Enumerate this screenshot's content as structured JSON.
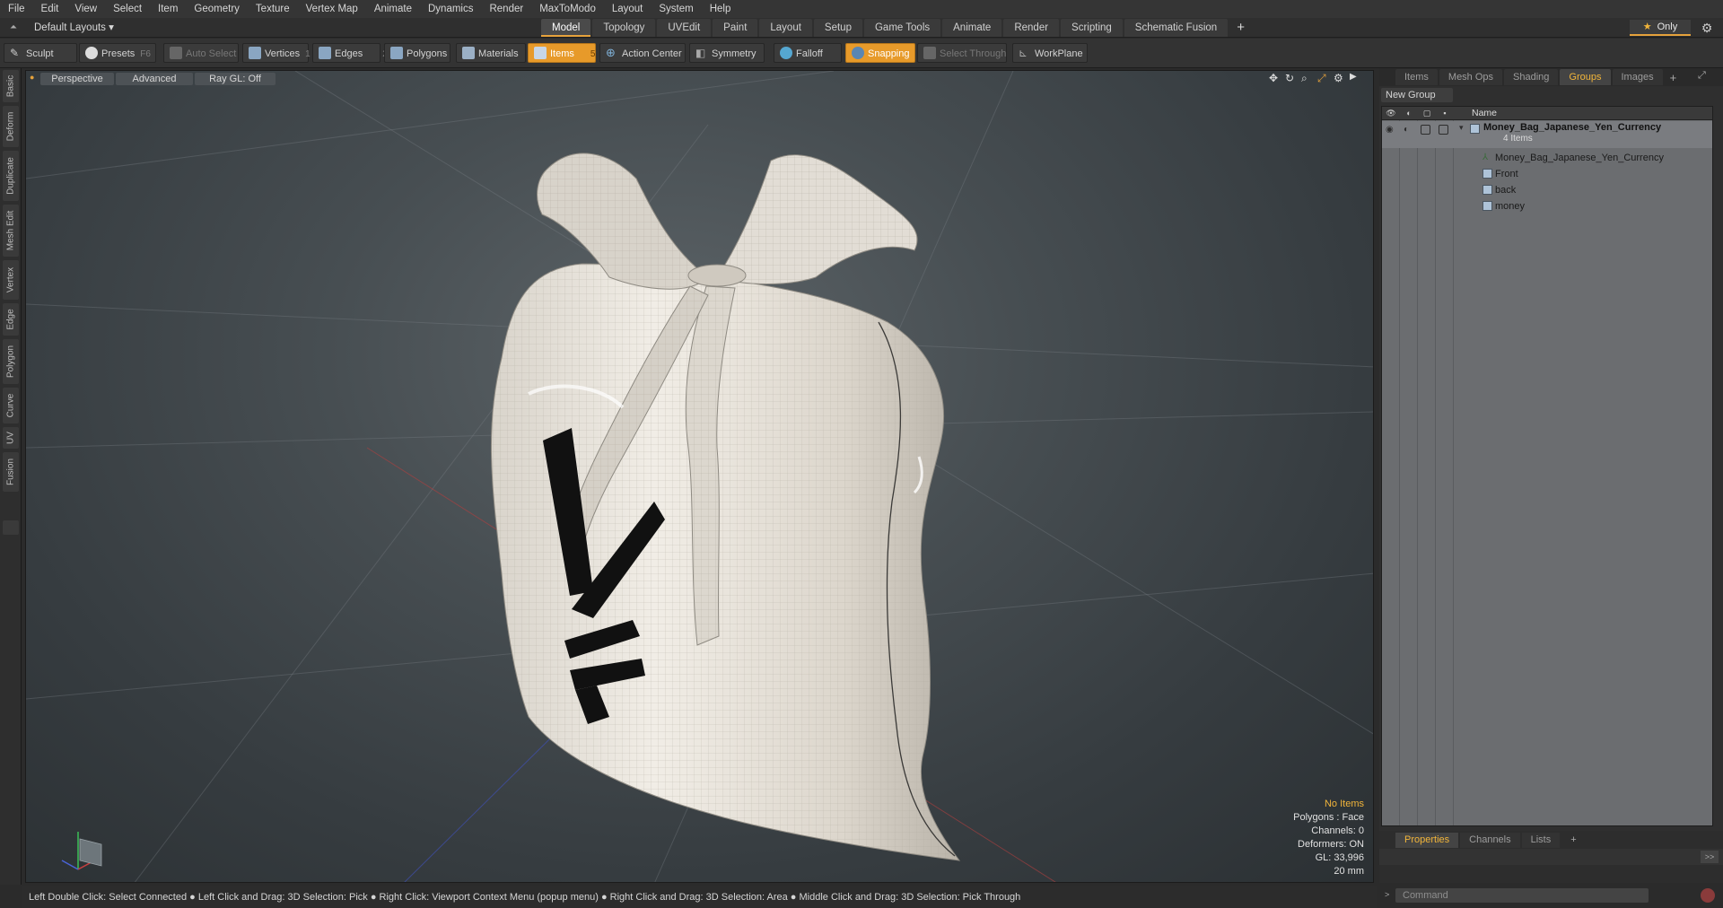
{
  "menu": [
    "File",
    "Edit",
    "View",
    "Select",
    "Item",
    "Geometry",
    "Texture",
    "Vertex Map",
    "Animate",
    "Dynamics",
    "Render",
    "MaxToModo",
    "Layout",
    "System",
    "Help"
  ],
  "layout": {
    "selector": "Default Layouts ▾"
  },
  "tabs": [
    "Model",
    "Topology",
    "UVEdit",
    "Paint",
    "Layout",
    "Setup",
    "Game Tools",
    "Animate",
    "Render",
    "Scripting",
    "Schematic Fusion"
  ],
  "active_tab": "Model",
  "only_label": "Only",
  "toolbar": {
    "sculpt": "Sculpt",
    "presets": "Presets",
    "presets_key": "F6",
    "auto_select": "Auto Select",
    "vertices": "Vertices",
    "vertices_key": "1",
    "edges": "Edges",
    "edges_key": "2",
    "polygons": "Polygons",
    "materials": "Materials",
    "items": "Items",
    "items_key": "5",
    "action_center": "Action Center",
    "symmetry": "Symmetry",
    "falloff": "Falloff",
    "snapping": "Snapping",
    "select_through": "Select Through",
    "workplane": "WorkPlane"
  },
  "left_tabs": [
    "Basic",
    "Deform",
    "Duplicate",
    "Mesh Edit",
    "Vertex",
    "Edge",
    "Polygon",
    "Curve",
    "UV",
    "Fusion"
  ],
  "viewport": {
    "view": "Perspective",
    "shading": "Advanced",
    "raygl": "Ray GL: Off",
    "status": {
      "items": "No Items",
      "polygons": "Polygons : Face",
      "channels": "Channels: 0",
      "deformers": "Deformers: ON",
      "gl": "GL: 33,996",
      "units": "20 mm"
    }
  },
  "right_panel": {
    "tabs": [
      "Items",
      "Mesh Ops",
      "Shading",
      "Groups",
      "Images"
    ],
    "active_tab": "Groups",
    "new_group": "New Group",
    "name_header": "Name",
    "group": {
      "name": "Money_Bag_Japanese_Yen_Currency",
      "count": "4 Items",
      "children": [
        "Money_Bag_Japanese_Yen_Currency",
        "Front",
        "back",
        "money"
      ]
    },
    "bottom_tabs": [
      "Properties",
      "Channels",
      "Lists"
    ],
    "bottom_active": "Properties",
    "command_placeholder": "Command"
  },
  "statusbar": "Left Double Click: Select Connected ● Left Click and Drag: 3D Selection: Pick ● Right Click: Viewport Context Menu (popup menu) ● Right Click and Drag: 3D Selection: Area ● Middle Click and Drag: 3D Selection: Pick Through",
  "colors": {
    "accent": "#e79a2a",
    "viewport_bg": "#474e52",
    "bag": "#e9e4db",
    "yen": "#111111"
  }
}
